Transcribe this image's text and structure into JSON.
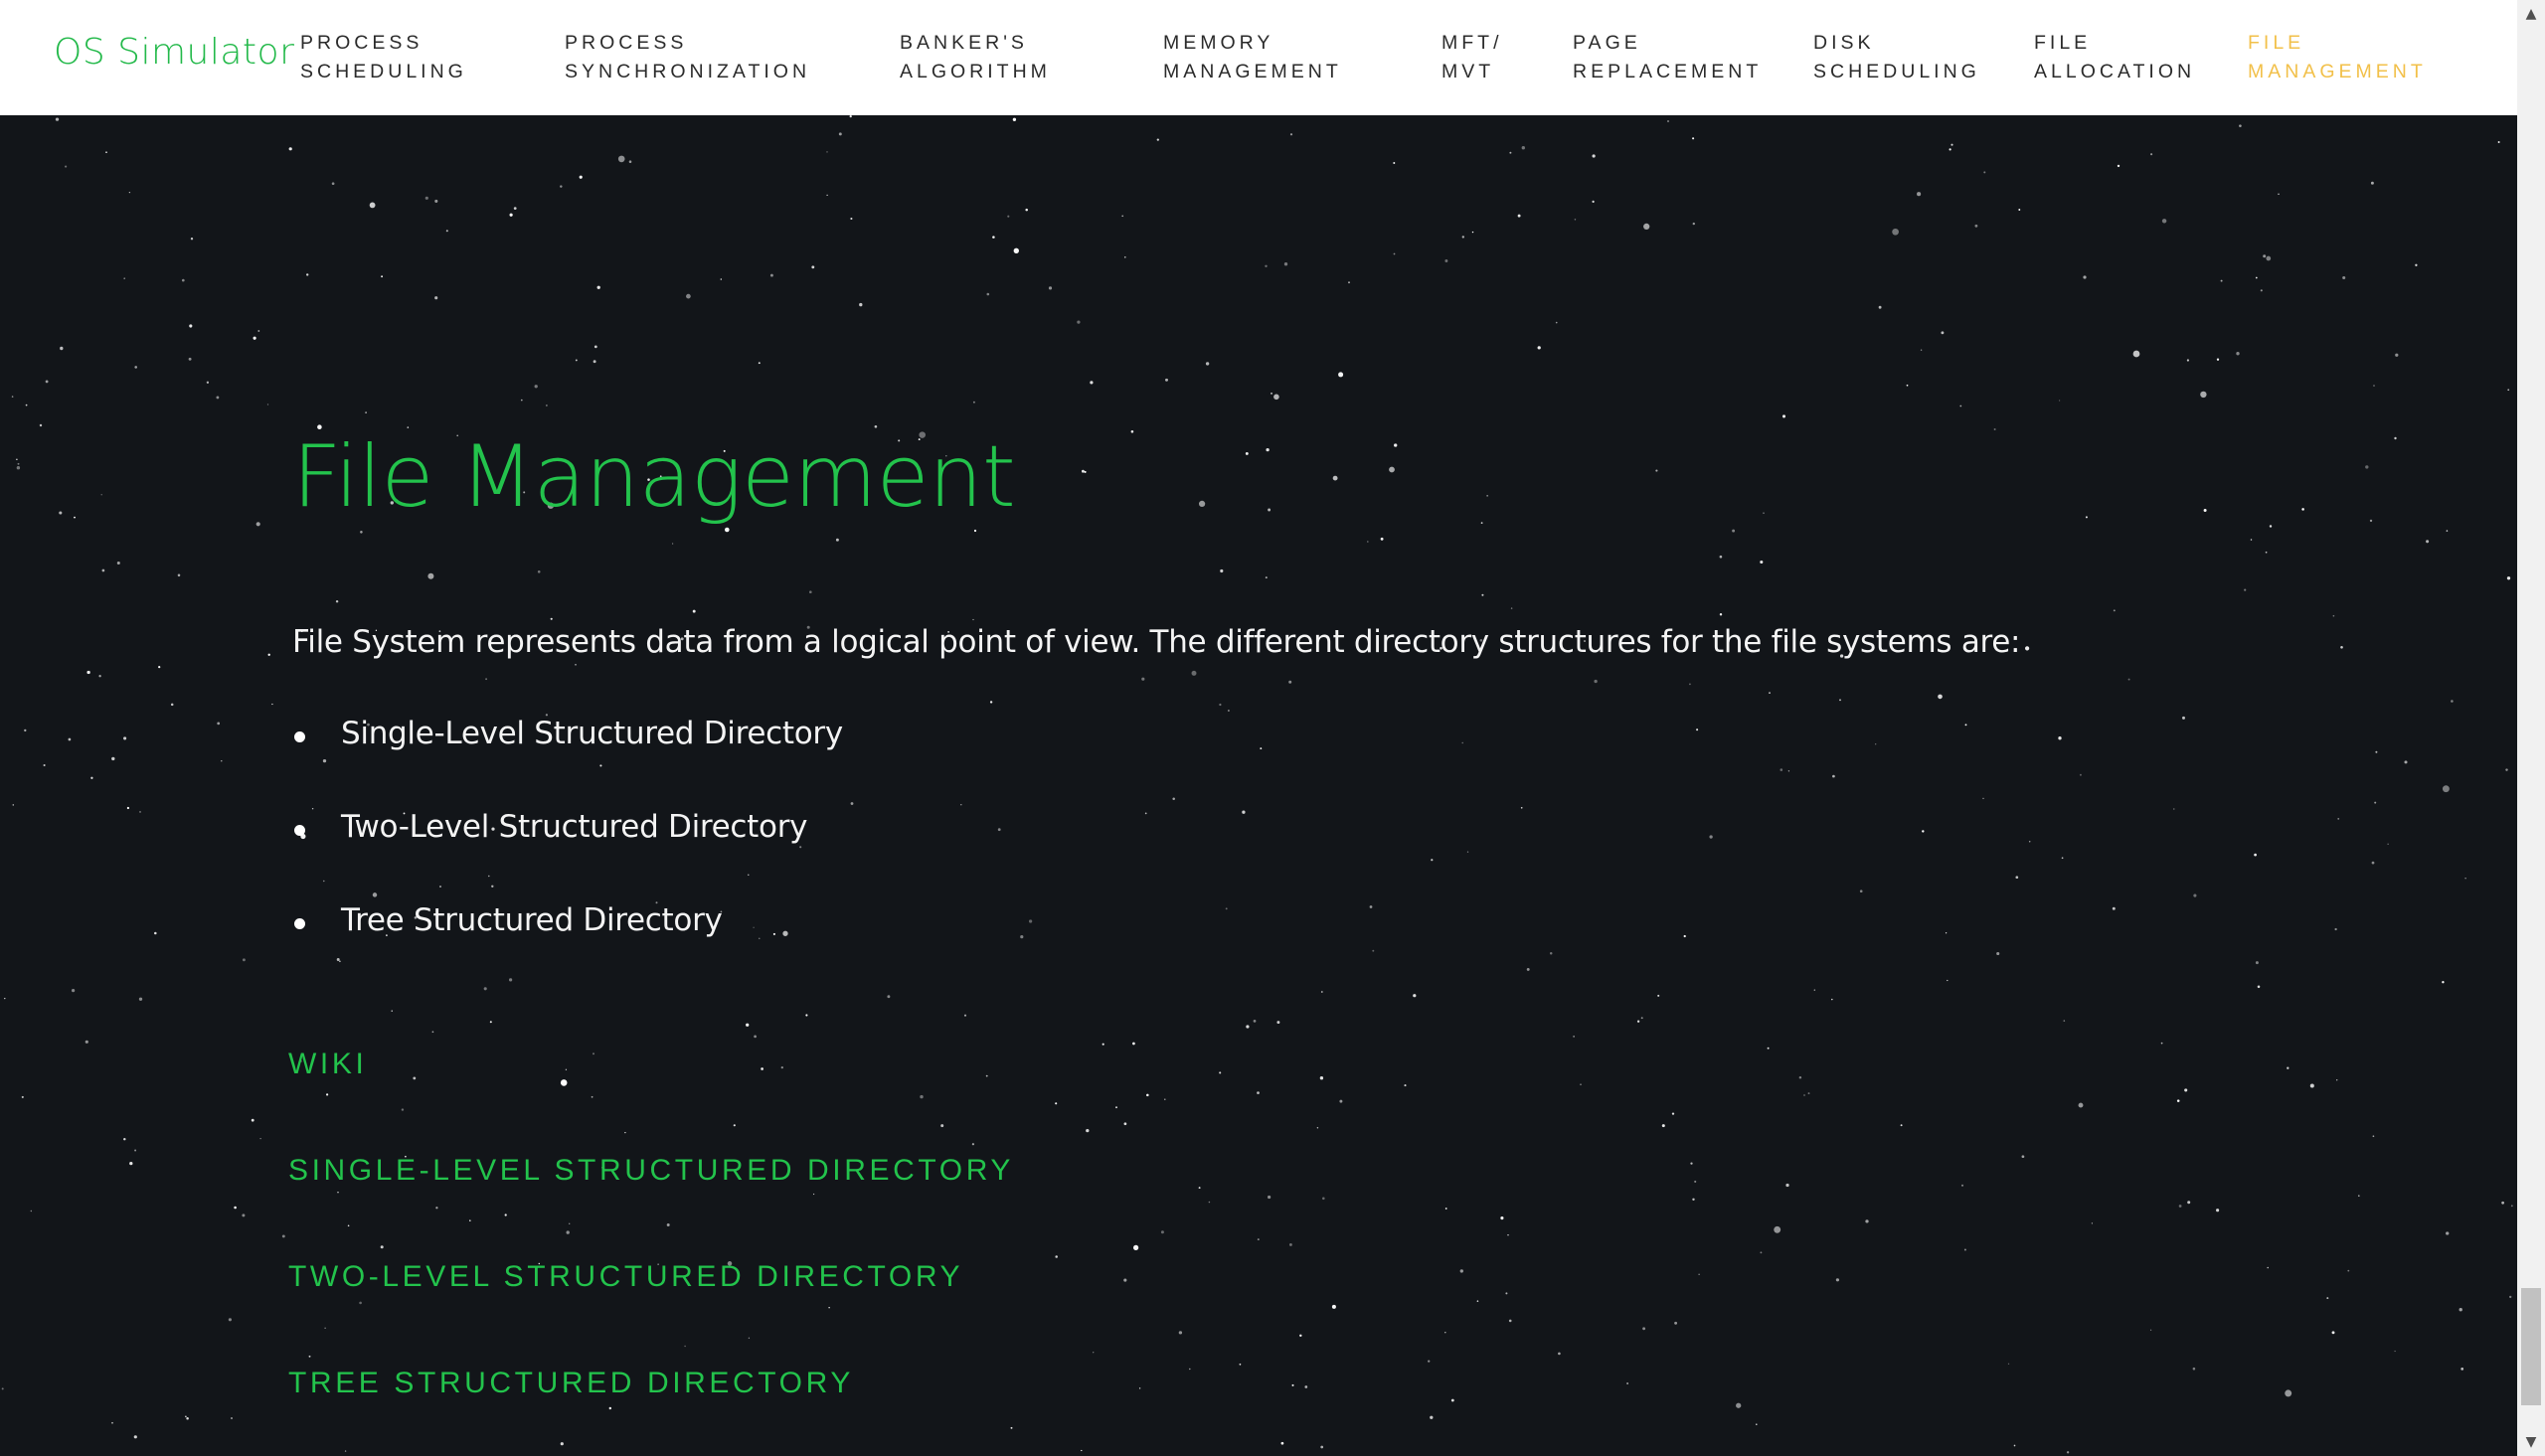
{
  "brand": "OS Simulator",
  "nav": [
    {
      "line1": "PROCESS",
      "line2": "SCHEDULING",
      "active": false
    },
    {
      "line1": "PROCESS",
      "line2": "SYNCHRONIZATION",
      "active": false
    },
    {
      "line1": "BANKER'S",
      "line2": "ALGORITHM",
      "active": false
    },
    {
      "line1": "MEMORY",
      "line2": "MANAGEMENT",
      "active": false
    },
    {
      "line1": "MFT/",
      "line2": "MVT",
      "active": false
    },
    {
      "line1": "PAGE",
      "line2": "REPLACEMENT",
      "active": false
    },
    {
      "line1": "DISK",
      "line2": "SCHEDULING",
      "active": false
    },
    {
      "line1": "FILE",
      "line2": "ALLOCATION",
      "active": false
    },
    {
      "line1": "FILE",
      "line2": "MANAGEMENT",
      "active": true
    }
  ],
  "main": {
    "title": "File Management",
    "intro": "File System represents data from a logical point of view. The different directory structures for the file systems are:",
    "structures": [
      "Single-Level Structured Directory",
      "Two-Level Structured Directory",
      "Tree Structured Directory"
    ],
    "links": [
      "WIKI",
      "SINGLE-LEVEL STRUCTURED DIRECTORY",
      "TWO-LEVEL STRUCTURED DIRECTORY",
      "TREE STRUCTURED DIRECTORY"
    ]
  },
  "colors": {
    "accent_green": "#23c34c",
    "active_nav": "#f2c04a",
    "background": "#121519",
    "navbar": "#ffffff"
  },
  "icons": {
    "scroll_up": "chevron-up-icon",
    "scroll_down": "chevron-down-icon"
  }
}
